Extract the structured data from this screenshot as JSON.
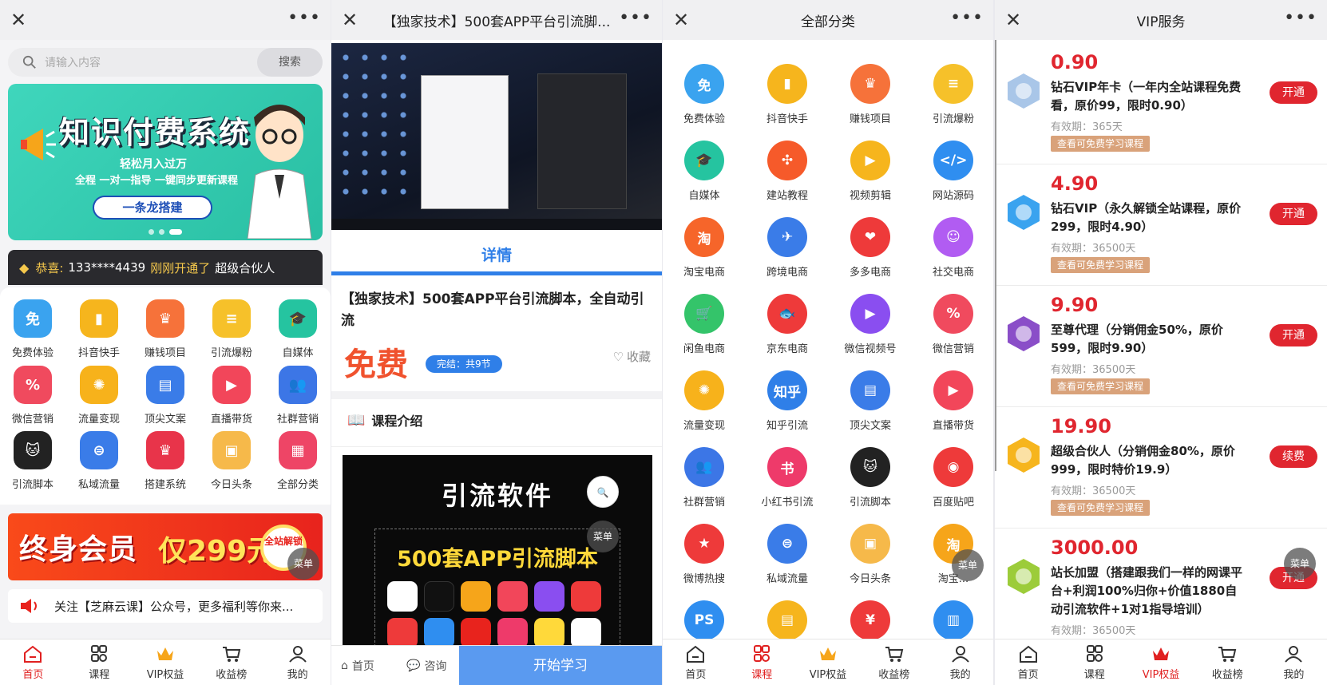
{
  "screen1": {
    "search": {
      "placeholder": "请输入内容",
      "button": "搜索"
    },
    "banner": {
      "title": "知识付费系统",
      "sub1": "轻松月入过万",
      "sub2": "全程 一对一指导 一键同步更新课程",
      "button": "一条龙搭建"
    },
    "notice": {
      "prefix": "恭喜:",
      "phone": "133****4439",
      "action": "刚刚开通了",
      "level": "超级合伙人"
    },
    "grid": [
      {
        "label": "免费体验",
        "glyph": "免",
        "color": "#3aa3ef",
        "icon": "ticket-icon"
      },
      {
        "label": "抖音快手",
        "glyph": "▮",
        "color": "#f6b51d",
        "icon": "book-icon"
      },
      {
        "label": "赚钱项目",
        "glyph": "♛",
        "color": "#f6723a",
        "icon": "crown-icon"
      },
      {
        "label": "引流爆粉",
        "glyph": "≡",
        "color": "#f6c12a",
        "icon": "note-icon"
      },
      {
        "label": "自媒体",
        "glyph": "🎓",
        "color": "#25c4a0",
        "icon": "graduation-cap-icon"
      },
      {
        "label": "微信营销",
        "glyph": "%",
        "color": "#f04a5e",
        "icon": "discount-icon"
      },
      {
        "label": "流量变现",
        "glyph": "✺",
        "color": "#f7b21b",
        "icon": "flow-icon"
      },
      {
        "label": "顶尖文案",
        "glyph": "▤",
        "color": "#3a7ce8",
        "icon": "document-icon"
      },
      {
        "label": "直播带货",
        "glyph": "▶",
        "color": "#f2465a",
        "icon": "video-icon"
      },
      {
        "label": "社群营销",
        "glyph": "👥",
        "color": "#3c76e6",
        "icon": "group-icon"
      },
      {
        "label": "引流脚本",
        "glyph": "🐱",
        "color": "#222222",
        "icon": "cat-icon"
      },
      {
        "label": "私域流量",
        "glyph": "⊜",
        "color": "#3a7ce8",
        "icon": "traffic-icon"
      },
      {
        "label": "搭建系统",
        "glyph": "♛",
        "color": "#e8344a",
        "icon": "crown-red-icon"
      },
      {
        "label": "今日头条",
        "glyph": "▣",
        "color": "#f6b94a",
        "icon": "box-icon"
      },
      {
        "label": "全部分类",
        "glyph": "▦",
        "color": "#ee4566",
        "icon": "grid-icon"
      }
    ],
    "banner2": {
      "title": "终身会员",
      "price": "仅299元",
      "badge": "全站解锁"
    },
    "bulletin": "关注【芝麻云课】公众号，更多福利等你来...",
    "fab": "菜单"
  },
  "screen2": {
    "title": "【独家技术】500套APP平台引流脚...",
    "tab": "详情",
    "course_title": "【独家技术】500套APP平台引流脚本，全自动引流",
    "price": "免费",
    "badge": "完结：共9节",
    "favorite": "收藏",
    "intro": "课程介绍",
    "promo_title": "引流软件",
    "promo_sub": "500套APP引流脚本",
    "fab": "菜单",
    "bottom": {
      "home": "首页",
      "consult": "咨询",
      "start": "开始学习"
    }
  },
  "screen3": {
    "title": "全部分类",
    "fab": "菜单",
    "categories": [
      {
        "label": "免费体验",
        "glyph": "免",
        "color": "#3aa3ef",
        "icon": "ticket-icon"
      },
      {
        "label": "抖音快手",
        "glyph": "▮",
        "color": "#f6b51d",
        "icon": "book-icon"
      },
      {
        "label": "赚钱项目",
        "glyph": "♛",
        "color": "#f6723a",
        "icon": "crown-icon"
      },
      {
        "label": "引流爆粉",
        "glyph": "≡",
        "color": "#f6c12a",
        "icon": "note-icon"
      },
      {
        "label": "自媒体",
        "glyph": "🎓",
        "color": "#25c4a0",
        "icon": "graduation-cap-icon"
      },
      {
        "label": "建站教程",
        "glyph": "✣",
        "color": "#f65a2a",
        "icon": "network-icon"
      },
      {
        "label": "视频剪辑",
        "glyph": "▶",
        "color": "#f6b51d",
        "icon": "clip-icon"
      },
      {
        "label": "网站源码",
        "glyph": "</>",
        "color": "#2f8ef0",
        "icon": "code-icon"
      },
      {
        "label": "淘宝电商",
        "glyph": "淘",
        "color": "#f6652a",
        "icon": "taobao-icon"
      },
      {
        "label": "跨境电商",
        "glyph": "✈",
        "color": "#3a7ce8",
        "icon": "plane-icon"
      },
      {
        "label": "多多电商",
        "glyph": "❤",
        "color": "#ee3a3a",
        "icon": "pinduoduo-icon"
      },
      {
        "label": "社交电商",
        "glyph": "☺",
        "color": "#b15cf2",
        "icon": "bag-icon"
      },
      {
        "label": "闲鱼电商",
        "glyph": "🛒",
        "color": "#34c46a",
        "icon": "cart-icon"
      },
      {
        "label": "京东电商",
        "glyph": "🐟",
        "color": "#ee3a3a",
        "icon": "jd-icon"
      },
      {
        "label": "微信视频号",
        "glyph": "▶",
        "color": "#8a4ef0",
        "icon": "tv-icon"
      },
      {
        "label": "微信营销",
        "glyph": "%",
        "color": "#f04a5e",
        "icon": "discount-icon"
      },
      {
        "label": "流量变现",
        "glyph": "✺",
        "color": "#f7b21b",
        "icon": "flow-icon"
      },
      {
        "label": "知乎引流",
        "glyph": "知乎",
        "color": "#2f7fe8",
        "icon": "zhihu-icon"
      },
      {
        "label": "顶尖文案",
        "glyph": "▤",
        "color": "#3a7ce8",
        "icon": "document-icon"
      },
      {
        "label": "直播带货",
        "glyph": "▶",
        "color": "#f2465a",
        "icon": "video-icon"
      },
      {
        "label": "社群营销",
        "glyph": "👥",
        "color": "#3c76e6",
        "icon": "group-icon"
      },
      {
        "label": "小红书引流",
        "glyph": "书",
        "color": "#ee3a6a",
        "icon": "xiaohongshu-icon"
      },
      {
        "label": "引流脚本",
        "glyph": "🐱",
        "color": "#222222",
        "icon": "cat-icon"
      },
      {
        "label": "百度贴吧",
        "glyph": "◉",
        "color": "#ee3a3a",
        "icon": "tieba-icon"
      },
      {
        "label": "微博热搜",
        "glyph": "★",
        "color": "#ee3a3a",
        "icon": "weibo-icon"
      },
      {
        "label": "私域流量",
        "glyph": "⊜",
        "color": "#3a7ce8",
        "icon": "traffic-icon"
      },
      {
        "label": "今日头条",
        "glyph": "▣",
        "color": "#f6b94a",
        "icon": "box-icon"
      },
      {
        "label": "淘宝...",
        "glyph": "淘",
        "color": "#f6a51a",
        "icon": "taobao-icon"
      },
      {
        "label": "",
        "glyph": "PS",
        "color": "#2f8ef0",
        "icon": "ps-icon"
      },
      {
        "label": "",
        "glyph": "▤",
        "color": "#f6b51d",
        "icon": "notepad-icon"
      },
      {
        "label": "",
        "glyph": "¥",
        "color": "#ee3a3a",
        "icon": "money-bag-icon"
      },
      {
        "label": "",
        "glyph": "▥",
        "color": "#2f8ef0",
        "icon": "chart-icon"
      }
    ]
  },
  "screen4": {
    "title": "VIP服务",
    "fab": "菜单",
    "free_link": "查看可免费学习课程",
    "items": [
      {
        "price": "0.90",
        "name": "钻石VIP年卡（一年内全站课程免费看，原价99，限时0.90）",
        "valid": "有效期：365天",
        "action": "开通",
        "color": "#a9c6e8",
        "icon": "diamond-badge-icon"
      },
      {
        "price": "4.90",
        "name": "钻石VIP（永久解锁全站课程，原价299，限时4.90）",
        "valid": "有效期：36500天",
        "action": "开通",
        "color": "#3aa3ef",
        "icon": "blue-badge-icon"
      },
      {
        "price": "9.90",
        "name": "至尊代理（分销佣金50%，原价599，限时9.90）",
        "valid": "有效期：36500天",
        "action": "开通",
        "color": "#8a4ec8",
        "icon": "purple-gem-icon"
      },
      {
        "price": "19.90",
        "name": "超级合伙人（分销佣金80%，原价999，限时特价19.9）",
        "valid": "有效期：36500天",
        "action": "续费",
        "color": "#f6b51d",
        "icon": "gold-crown-icon"
      },
      {
        "price": "3000.00",
        "name": "站长加盟（搭建跟我们一样的网课平台+利润100%归你+价值1880自动引流软件+1对1指导培训）",
        "valid": "有效期：36500天",
        "action": "开通",
        "color": "#9ccc3a",
        "icon": "green-star-icon"
      }
    ]
  },
  "tabs": [
    "首页",
    "课程",
    "VIP权益",
    "收益榜",
    "我的"
  ],
  "accent": "#e02020"
}
